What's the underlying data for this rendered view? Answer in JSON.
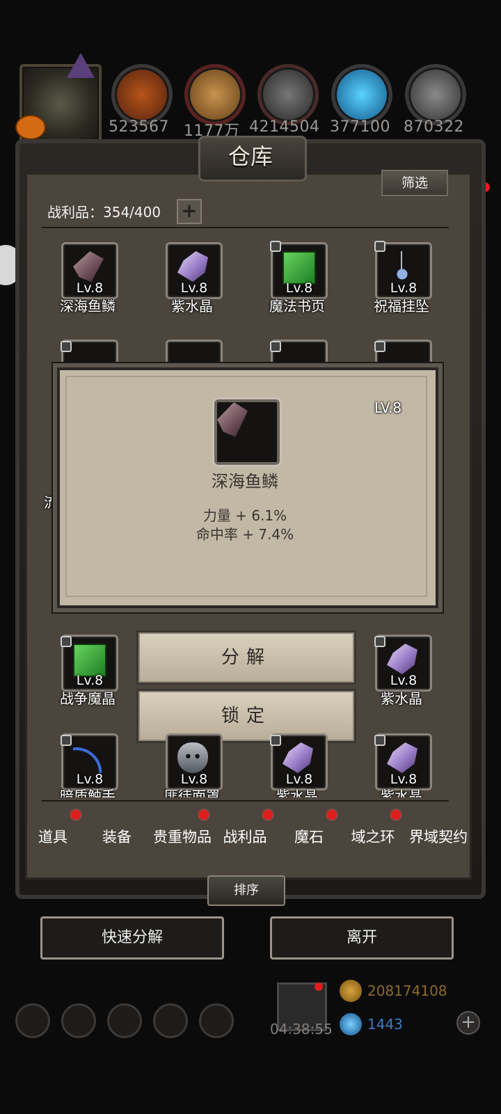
{
  "resources": [
    {
      "icon": "wood-resource-icon",
      "value": "523567"
    },
    {
      "icon": "plank-resource-icon",
      "value": "1177万"
    },
    {
      "icon": "iron-resource-icon",
      "value": "4214504"
    },
    {
      "icon": "crystal-resource-icon",
      "value": "377100"
    },
    {
      "icon": "steel-resource-icon",
      "value": "870322"
    }
  ],
  "warehouse": {
    "title": "仓库",
    "filter_label": "筛选",
    "loot_count": "战利品：354/400",
    "plus": "+"
  },
  "items_row1": [
    {
      "name": "深海鱼鳞",
      "level": "Lv.8",
      "icon": "scale-icon"
    },
    {
      "name": "紫水晶",
      "level": "Lv.8",
      "icon": "amethyst-icon"
    },
    {
      "name": "魔法书页",
      "level": "Lv.8",
      "icon": "spellbook-page-icon"
    },
    {
      "name": "祝福挂坠",
      "level": "Lv.8",
      "icon": "pendant-icon"
    }
  ],
  "items_row5": [
    {
      "name": "战争魔晶",
      "level": "Lv.8",
      "icon": "war-crystal-icon"
    },
    {
      "name": "紫水晶",
      "level": "Lv.8",
      "icon": "amethyst-icon"
    }
  ],
  "items_row6": [
    {
      "name": "暗质触手",
      "level": "Lv.8",
      "icon": "tentacle-icon"
    },
    {
      "name": "匪徒面罩",
      "level": "Lv.8",
      "icon": "bandit-mask-icon"
    },
    {
      "name": "紫水晶",
      "level": "Lv.8",
      "icon": "amethyst-icon"
    },
    {
      "name": "紫水晶",
      "level": "Lv.8",
      "icon": "amethyst-icon"
    }
  ],
  "partial_label": "流",
  "popup": {
    "level": "LV.8",
    "name": "深海鱼鳞",
    "stats": [
      "力量 + 6.1%",
      "命中率 + 7.4%"
    ]
  },
  "actions": {
    "decompose": "分解",
    "lock": "锁定"
  },
  "tabs": [
    "道具",
    "装备",
    "贵重物品",
    "战利品",
    "魔石",
    "域之环",
    "界域契约"
  ],
  "sort_label": "排序",
  "bottom": {
    "quick_decompose": "快速分解",
    "leave": "离开"
  },
  "footer": {
    "timer": "04:38:55",
    "gold": "208174108",
    "gems": "1443",
    "plus": "+"
  },
  "colors": {
    "gold_text": "#8c6a2c",
    "gem_text": "#3b7bc4",
    "badge_red": "#e01d1d"
  }
}
